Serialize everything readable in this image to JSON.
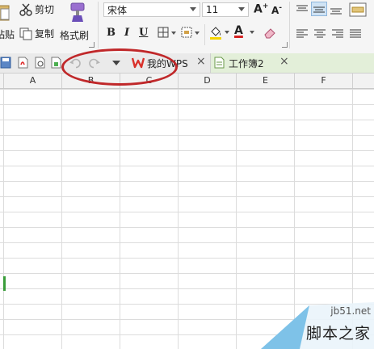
{
  "ribbon": {
    "cut_label": "剪切",
    "paste_label": "粘贴",
    "copy_label": "复制",
    "format_painter_label": "格式刷",
    "font_name": "宋体",
    "font_size": "11",
    "bold": "B",
    "italic": "I",
    "underline": "U",
    "font_color_letter": "A",
    "grow_font": "A",
    "grow_font_sup": "+",
    "shrink_font": "A",
    "shrink_font_sup": "-"
  },
  "tabs": {
    "wps_label": "我的WPS",
    "workbook_label": "工作簿2",
    "close_glyph": "×"
  },
  "columns": [
    "A",
    "B",
    "C",
    "D",
    "E",
    "F"
  ],
  "watermark": {
    "site": "jb51.net",
    "name": "脚本之家"
  },
  "colors": {
    "highlight_oval": "#c0282a",
    "wps_logo": "#d9312b",
    "active_tab": "#e3efd9",
    "font_color_bar": "#d42020"
  }
}
